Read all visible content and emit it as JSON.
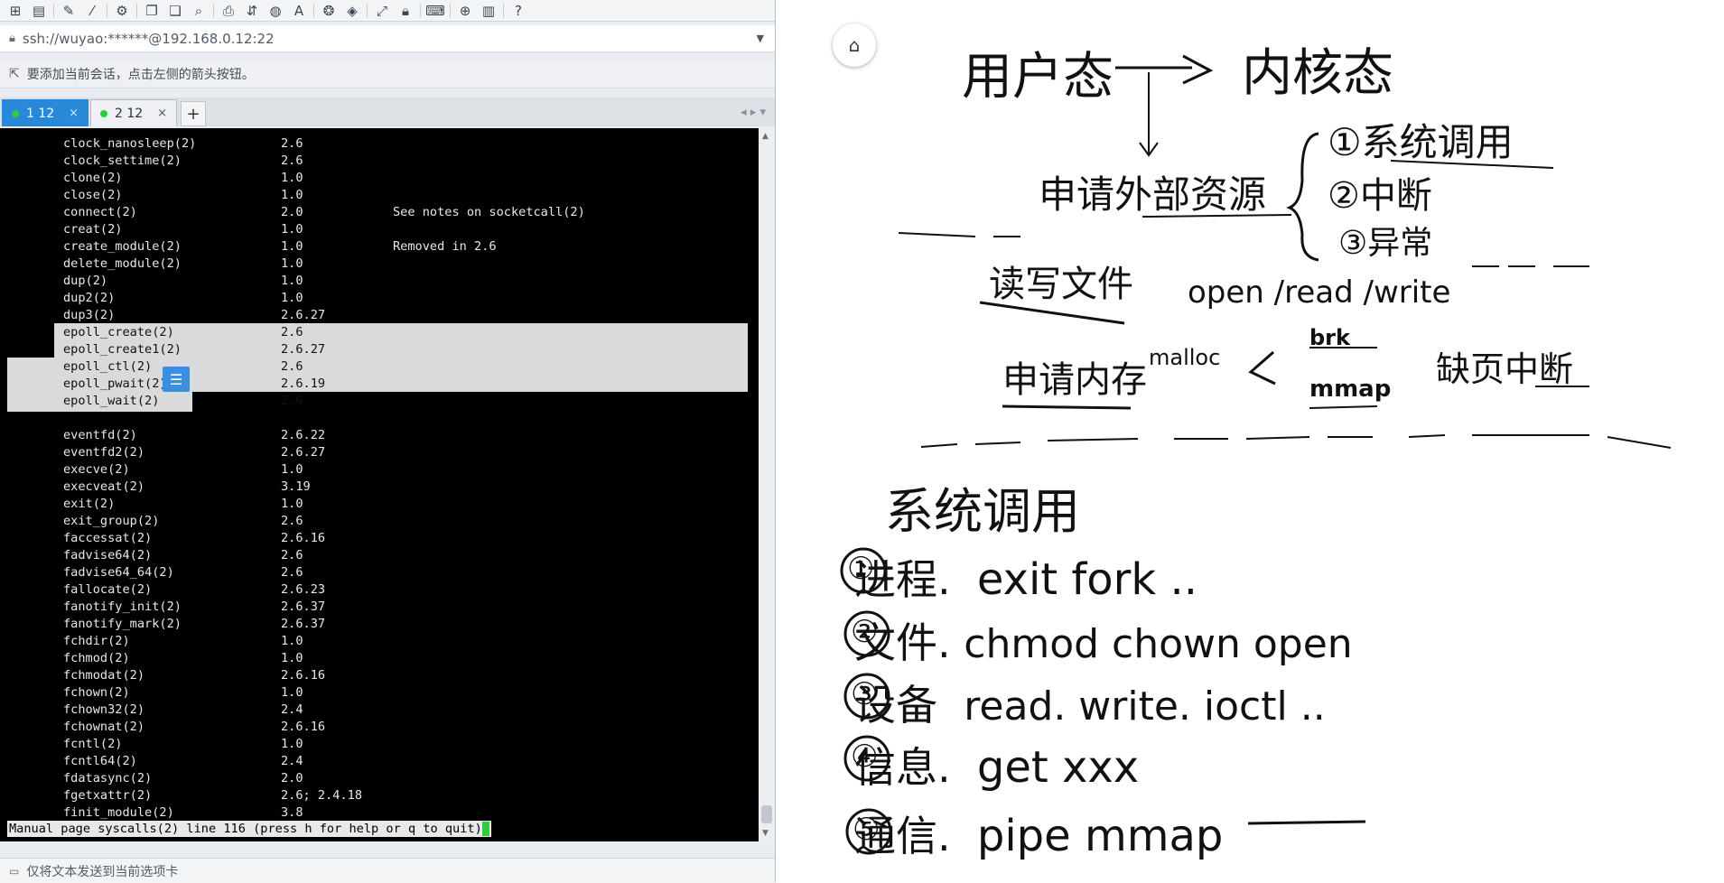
{
  "client": {
    "address": "ssh://wuyao:******@192.168.0.12:22",
    "hint": "要添加当前会话，点击左侧的箭头按钮。",
    "tabs": [
      {
        "label": "1 12",
        "active": true
      },
      {
        "label": "2 12",
        "active": false
      }
    ],
    "send_hint": "仅将文本发送到当前选项卡",
    "terminal": {
      "rows": [
        {
          "name": "clock_nanosleep(2)",
          "ver": "2.6",
          "note": ""
        },
        {
          "name": "clock_settime(2)",
          "ver": "2.6",
          "note": ""
        },
        {
          "name": "clone(2)",
          "ver": "1.0",
          "note": ""
        },
        {
          "name": "close(2)",
          "ver": "1.0",
          "note": ""
        },
        {
          "name": "connect(2)",
          "ver": "2.0",
          "note": "See notes on socketcall(2)"
        },
        {
          "name": "creat(2)",
          "ver": "1.0",
          "note": ""
        },
        {
          "name": "create_module(2)",
          "ver": "1.0",
          "note": "Removed in 2.6"
        },
        {
          "name": "delete_module(2)",
          "ver": "1.0",
          "note": ""
        },
        {
          "name": "dup(2)",
          "ver": "1.0",
          "note": ""
        },
        {
          "name": "dup2(2)",
          "ver": "1.0",
          "note": ""
        },
        {
          "name": "dup3(2)",
          "ver": "2.6.27",
          "note": ""
        },
        {
          "name": "epoll_create(2)",
          "ver": "2.6",
          "note": ""
        },
        {
          "name": "epoll_create1(2)",
          "ver": "2.6.27",
          "note": ""
        },
        {
          "name": "epoll_ctl(2)",
          "ver": "2.6",
          "note": ""
        },
        {
          "name": "epoll_pwait(2)",
          "ver": "2.6.19",
          "note": ""
        },
        {
          "name": "epoll_wait(2)",
          "ver": "2.6",
          "note": ""
        },
        {
          "name": "",
          "ver": "",
          "note": ""
        },
        {
          "name": "eventfd(2)",
          "ver": "2.6.22",
          "note": ""
        },
        {
          "name": "eventfd2(2)",
          "ver": "2.6.27",
          "note": ""
        },
        {
          "name": "execve(2)",
          "ver": "1.0",
          "note": ""
        },
        {
          "name": "execveat(2)",
          "ver": "3.19",
          "note": ""
        },
        {
          "name": "exit(2)",
          "ver": "1.0",
          "note": ""
        },
        {
          "name": "exit_group(2)",
          "ver": "2.6",
          "note": ""
        },
        {
          "name": "faccessat(2)",
          "ver": "2.6.16",
          "note": ""
        },
        {
          "name": "fadvise64(2)",
          "ver": "2.6",
          "note": ""
        },
        {
          "name": "fadvise64_64(2)",
          "ver": "2.6",
          "note": ""
        },
        {
          "name": "fallocate(2)",
          "ver": "2.6.23",
          "note": ""
        },
        {
          "name": "fanotify_init(2)",
          "ver": "2.6.37",
          "note": ""
        },
        {
          "name": "fanotify_mark(2)",
          "ver": "2.6.37",
          "note": ""
        },
        {
          "name": "fchdir(2)",
          "ver": "1.0",
          "note": ""
        },
        {
          "name": "fchmod(2)",
          "ver": "1.0",
          "note": ""
        },
        {
          "name": "fchmodat(2)",
          "ver": "2.6.16",
          "note": ""
        },
        {
          "name": "fchown(2)",
          "ver": "1.0",
          "note": ""
        },
        {
          "name": "fchown32(2)",
          "ver": "2.4",
          "note": ""
        },
        {
          "name": "fchownat(2)",
          "ver": "2.6.16",
          "note": ""
        },
        {
          "name": "fcntl(2)",
          "ver": "1.0",
          "note": ""
        },
        {
          "name": "fcntl64(2)",
          "ver": "2.4",
          "note": ""
        },
        {
          "name": "fdatasync(2)",
          "ver": "2.0",
          "note": ""
        },
        {
          "name": "fgetxattr(2)",
          "ver": "2.6; 2.4.18",
          "note": ""
        },
        {
          "name": "finit_module(2)",
          "ver": "3.8",
          "note": ""
        }
      ],
      "status": "Manual page syscalls(2) line 116 (press h for help or q to quit)"
    }
  },
  "board": {
    "title_left": "用户态",
    "title_right": "内核态",
    "apply_resource": "申请外部资源",
    "branches": [
      "①系统调用",
      "②中断",
      "③异常"
    ],
    "rw_files": "读写文件",
    "rw_calls": "open /read /write",
    "apply_memory": "申请内存",
    "malloc": "malloc",
    "brk": "brk",
    "mmap": "mmap",
    "page_fault": "缺页中断",
    "section": "系统调用",
    "items": [
      {
        "num": "①",
        "cat": "进程.",
        "calls": "exit  fork .."
      },
      {
        "num": "②",
        "cat": "文件.",
        "calls": "chmod  chown open"
      },
      {
        "num": "③",
        "cat": "设备",
        "calls": "read. write. ioctl .."
      },
      {
        "num": "④",
        "cat": "信息.",
        "calls": "get xxx"
      },
      {
        "num": "⑤",
        "cat": "通信.",
        "calls": "pipe  mmap"
      }
    ]
  }
}
